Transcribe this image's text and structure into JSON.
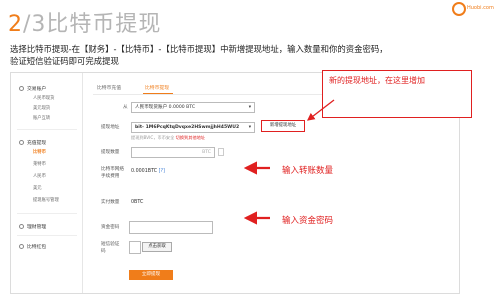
{
  "slide": {
    "title_num": "2",
    "title_rest": "/3比特币提现",
    "logo_brand": "Huobi.com",
    "instruction_line1": "选择比特币提现-在【财务】-【比特币】-【比特币提现】中新增提现地址，输入数量和你的资金密码，",
    "instruction_line2": "验证短信验证码即可完成提现"
  },
  "sidebar": {
    "groups": [
      {
        "label": "交易账户",
        "items": [
          "人民币现货",
          "美元现货",
          "账户互转"
        ]
      },
      {
        "label": "充值提现",
        "items": [
          "比特币",
          "莱特币",
          "人民币",
          "美元",
          "提现账号管理"
        ]
      },
      {
        "label": "理财管理",
        "items": []
      },
      {
        "label": "比特红包",
        "items": []
      }
    ],
    "active_item": "比特币"
  },
  "tabs": [
    {
      "label": "比特币充值",
      "active": false
    },
    {
      "label": "比特币提现",
      "active": true
    }
  ],
  "form": {
    "from_label": "从",
    "from_value": "人民币现货账户 0.0000 BTC",
    "address_label": "提现地址",
    "address_value": "bit- 1M6PcqKtqDvqxe2HSwmjjhH45WU2",
    "address_hint": "提现到BVIC，币币安全",
    "address_warn": "切换到其他地址",
    "add_address_button": "新增提现地址",
    "amount_label": "提现数量",
    "amount_unit": "BTC",
    "fee_label_line1": "比特币网络",
    "fee_label_line2": "手续费用",
    "fee_value": "0.0001BTC",
    "fee_help": "[?]",
    "actual_label": "实付数量",
    "actual_value": "0BTC",
    "password_label": "资金密码",
    "sms_label_line1": "短信验证",
    "sms_label_line2": "码",
    "sms_button": "点击获取",
    "submit_button": "立即提现"
  },
  "callouts": {
    "new_address": "新的提现地址，在这里增加",
    "input_amount": "输入转账数量",
    "input_password": "输入资金密码"
  },
  "colors": {
    "accent": "#f07d1a",
    "callout": "#e02020"
  }
}
